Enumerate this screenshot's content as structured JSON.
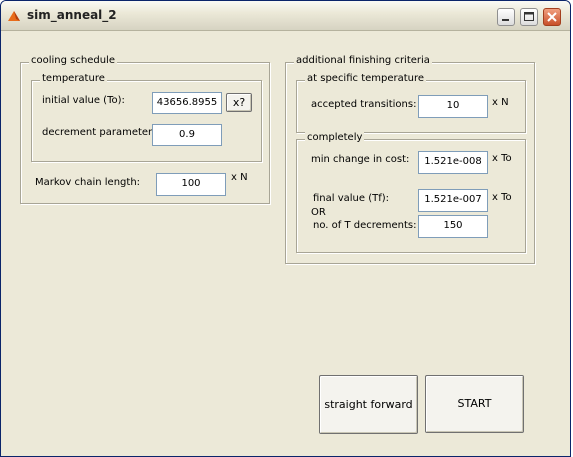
{
  "window": {
    "title": "sim_anneal_2",
    "accent": "#0a246a",
    "background": "#ece9d8"
  },
  "titlebar_buttons": {
    "minimize": "minimize-icon",
    "maximize": "maximize-icon",
    "close": "close-icon"
  },
  "cooling": {
    "legend": "cooling schedule",
    "temperature_legend": "temperature",
    "initial_value_label": "initial value (To):",
    "initial_value": "43656.8955",
    "help_button": "x?",
    "decrement_label": "decrement  parameter:",
    "decrement_value": "0.9",
    "markov_label": "Markov chain length:",
    "markov_value": "100",
    "markov_unit": "x N"
  },
  "finishing": {
    "legend": "additional finishing criteria",
    "specific_legend": "at specific temperature",
    "accepted_label": "accepted transitions:",
    "accepted_value": "10",
    "accepted_unit": "x N",
    "completely_legend": "completely",
    "min_change_label": "min change in cost:",
    "min_change_value": "1.521e-008",
    "min_change_unit": "x To",
    "final_value_label": "final value (Tf):",
    "final_value": "1.521e-007",
    "final_value_unit": "x To",
    "or_label": "OR",
    "decrements_label": "no. of T decrements:",
    "decrements_value": "150"
  },
  "actions": {
    "straight_forward": "straight forward",
    "start": "START"
  }
}
